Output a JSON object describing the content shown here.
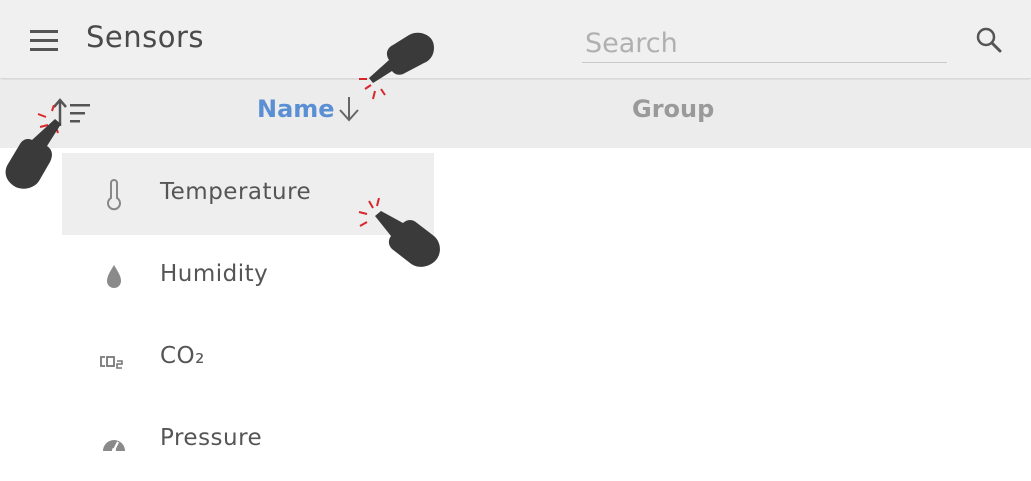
{
  "appbar": {
    "title": "Sensors",
    "search_placeholder": "Search"
  },
  "icons": {
    "menu": "menu-icon",
    "search": "search-icon",
    "sort": "sort-icon"
  },
  "columns": {
    "name": "Name",
    "group": "Group"
  },
  "sort_menu": {
    "items": [
      {
        "label": "Temperature",
        "icon": "thermometer-icon",
        "selected": true
      },
      {
        "label": "Humidity",
        "icon": "droplet-icon",
        "selected": false
      },
      {
        "label": "CO₂",
        "icon": "co2-icon",
        "selected": false
      },
      {
        "label": "Pressure",
        "icon": "gauge-icon",
        "selected": false
      }
    ]
  },
  "colors": {
    "accent": "#5b8fd4",
    "appbar": "#f0f0f0",
    "header_row": "#ececec",
    "tap_marker": "#d9262c"
  }
}
